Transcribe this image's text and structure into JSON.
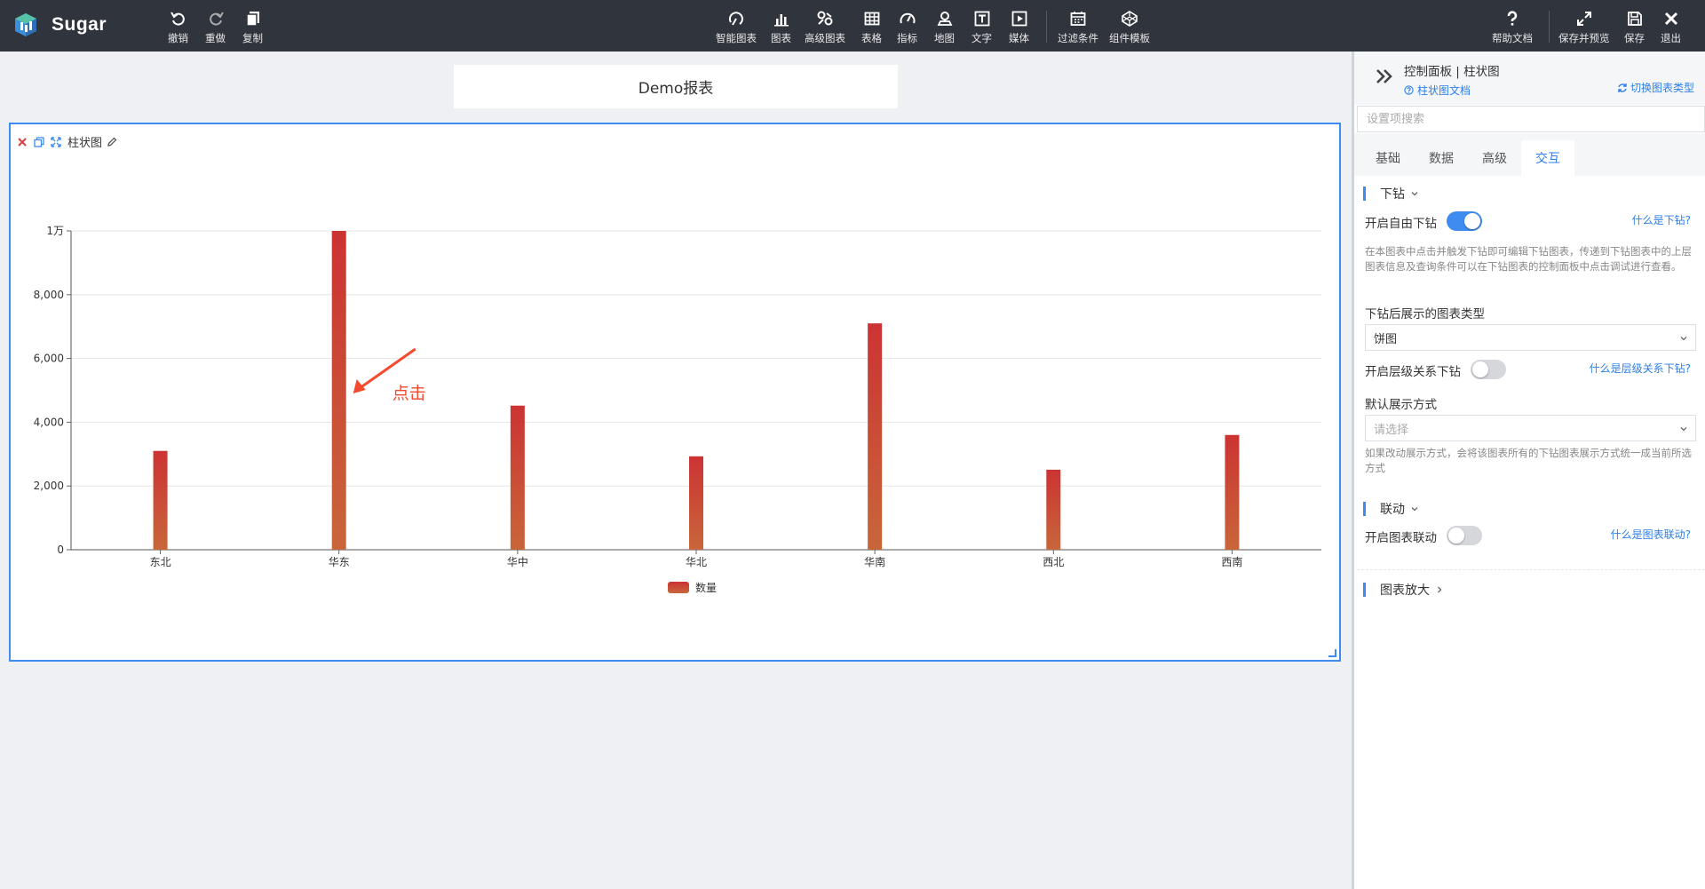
{
  "app": {
    "name": "Sugar"
  },
  "toolbar": {
    "undo": "撤销",
    "redo": "重做",
    "copy": "复制",
    "smart_chart": "智能图表",
    "chart": "图表",
    "advanced_chart": "高级图表",
    "table": "表格",
    "metric": "指标",
    "map": "地图",
    "text": "文字",
    "media": "媒体",
    "filter": "过滤条件",
    "template": "组件模板",
    "help": "帮助文档",
    "save_preview": "保存并预览",
    "save": "保存",
    "exit": "退出"
  },
  "report": {
    "title": "Demo报表"
  },
  "card": {
    "title": "柱状图"
  },
  "chart_data": {
    "type": "bar",
    "categories": [
      "东北",
      "华东",
      "华中",
      "华北",
      "华南",
      "西北",
      "西南"
    ],
    "series": [
      {
        "name": "数量",
        "values": [
          3100,
          10000,
          4520,
          2930,
          7100,
          2510,
          3600
        ]
      }
    ],
    "ylim": [
      0,
      10000
    ],
    "yticks": [
      0,
      2000,
      4000,
      6000,
      8000,
      10000
    ],
    "ytick_labels": [
      "0",
      "2,000",
      "4,000",
      "6,000",
      "8,000",
      "1万"
    ],
    "grid": true,
    "legend": "bottom-center",
    "colors": [
      "#cc3333",
      "#c8663a"
    ],
    "annotation": {
      "text": "点击",
      "target_category": "华东",
      "color": "#f44a2e"
    }
  },
  "panel": {
    "title": "控制面板 | 柱状图",
    "doc_link": "柱状图文档",
    "switch_type": "切换图表类型",
    "search_placeholder": "设置项搜索",
    "tabs": [
      "基础",
      "数据",
      "高级",
      "交互"
    ],
    "active_tab": "交互",
    "drill": {
      "section": "下钻",
      "free_drill_label": "开启自由下钻",
      "free_drill_on": true,
      "what_is_drill": "什么是下钻?",
      "description": "在本图表中点击并触发下钻即可编辑下钻图表，传递到下钻图表中的上层图表信息及查询条件可以在下钻图表的控制面板中点击调试进行查看。",
      "chart_type_label": "下钻后展示的图表类型",
      "chart_type_value": "饼图",
      "hier_drill_label": "开启层级关系下钻",
      "hier_drill_on": false,
      "what_is_hier": "什么是层级关系下钻?",
      "display_label": "默认展示方式",
      "display_placeholder": "请选择",
      "display_desc": "如果改动展示方式，会将该图表所有的下钻图表展示方式统一成当前所选方式"
    },
    "linkage": {
      "section": "联动",
      "label": "开启图表联动",
      "on": false,
      "what_is": "什么是图表联动?"
    },
    "zoom": {
      "section": "图表放大"
    }
  },
  "colors": {
    "accent": "#3f8cf0",
    "topbar": "#30343d",
    "link": "#2d7ee8"
  }
}
